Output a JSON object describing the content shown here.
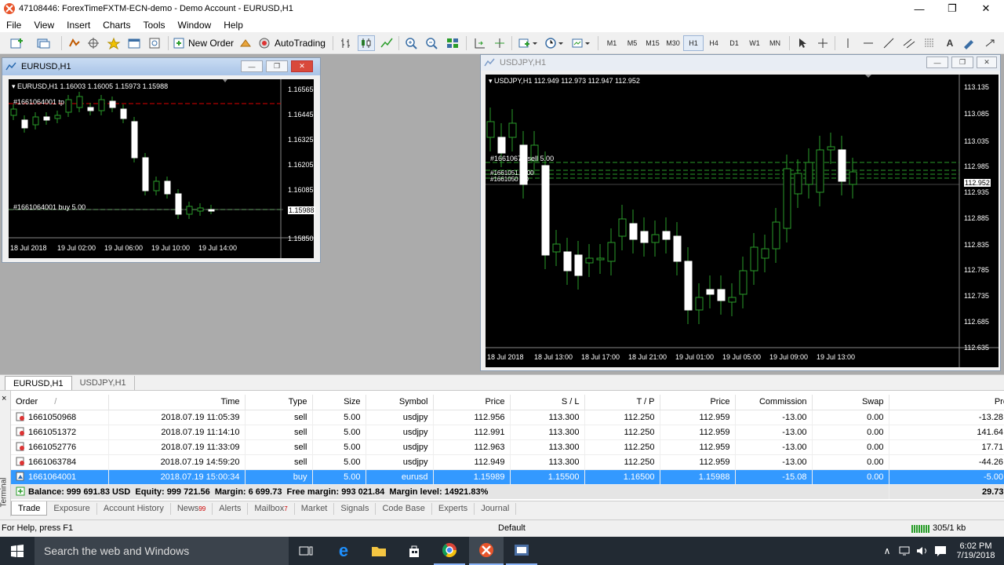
{
  "window": {
    "title": "47108446: ForexTimeFXTM-ECN-demo - Demo Account - EURUSD,H1"
  },
  "menu": [
    "File",
    "View",
    "Insert",
    "Charts",
    "Tools",
    "Window",
    "Help"
  ],
  "toolbar": {
    "new_order": "New Order",
    "autotrading": "AutoTrading",
    "timeframes": [
      "M1",
      "M5",
      "M15",
      "M30",
      "H1",
      "H4",
      "D1",
      "W1",
      "MN"
    ],
    "active_tf": "H1"
  },
  "eurusd": {
    "window_title": "EURUSD,H1",
    "header": "EURUSD,H1  1.16003 1.16005 1.15973 1.15988",
    "price_labels": [
      "1.16565",
      "1.16445",
      "1.16325",
      "1.16205",
      "1.16085",
      "1.15988",
      "1.15850"
    ],
    "time_labels": [
      "18 Jul 2018",
      "19 Jul 02:00",
      "19 Jul 06:00",
      "19 Jul 10:00",
      "19 Jul 14:00"
    ],
    "tp_label": "#1661064001 tp",
    "buy_label": "#1661064001 buy 5.00"
  },
  "usdjpy": {
    "window_title": "USDJPY,H1",
    "header": "USDJPY,H1  112.949 112.973 112.947 112.952",
    "price_labels": [
      "113.135",
      "113.085",
      "113.035",
      "112.985",
      "112.952",
      "112.935",
      "112.885",
      "112.835",
      "112.785",
      "112.735",
      "112.685",
      "112.635"
    ],
    "time_labels": [
      "18 Jul 2018",
      "18 Jul 13:00",
      "18 Jul 17:00",
      "18 Jul 21:00",
      "19 Jul 01:00",
      "19 Jul 05:00",
      "19 Jul 09:00",
      "19 Jul 13:00"
    ],
    "sell_label": "#16610672 sell 5.00",
    "sell_label_2": "#1661051. 5.00",
    "sell_label_3": "#1661050 .00"
  },
  "chart_tabs": [
    "EURUSD,H1",
    "USDJPY,H1"
  ],
  "orders": {
    "columns": [
      "Order",
      "Time",
      "Type",
      "Size",
      "Symbol",
      "Price",
      "S / L",
      "T / P",
      "Price",
      "Commission",
      "Swap",
      "Profit"
    ],
    "sort_mark": "/",
    "rows": [
      {
        "order": "1661050968",
        "time": "2018.07.19 11:05:39",
        "type": "sell",
        "size": "5.00",
        "symbol": "usdjpy",
        "price": "112.956",
        "sl": "113.300",
        "tp": "112.250",
        "cur": "112.959",
        "commission": "-13.00",
        "swap": "0.00",
        "profit": "-13.28"
      },
      {
        "order": "1661051372",
        "time": "2018.07.19 11:14:10",
        "type": "sell",
        "size": "5.00",
        "symbol": "usdjpy",
        "price": "112.991",
        "sl": "113.300",
        "tp": "112.250",
        "cur": "112.959",
        "commission": "-13.00",
        "swap": "0.00",
        "profit": "141.64"
      },
      {
        "order": "1661052776",
        "time": "2018.07.19 11:33:09",
        "type": "sell",
        "size": "5.00",
        "symbol": "usdjpy",
        "price": "112.963",
        "sl": "113.300",
        "tp": "112.250",
        "cur": "112.959",
        "commission": "-13.00",
        "swap": "0.00",
        "profit": "17.71"
      },
      {
        "order": "1661063784",
        "time": "2018.07.19 14:59:20",
        "type": "sell",
        "size": "5.00",
        "symbol": "usdjpy",
        "price": "112.949",
        "sl": "113.300",
        "tp": "112.250",
        "cur": "112.959",
        "commission": "-13.00",
        "swap": "0.00",
        "profit": "-44.26"
      },
      {
        "order": "1661064001",
        "time": "2018.07.19 15:00:34",
        "type": "buy",
        "size": "5.00",
        "symbol": "eurusd",
        "price": "1.15989",
        "sl": "1.15500",
        "tp": "1.16500",
        "cur": "1.15988",
        "commission": "-15.08",
        "swap": "0.00",
        "profit": "-5.00"
      }
    ],
    "balance_line": "Balance: 999 691.83 USD  Equity: 999 721.56  Margin: 6 699.73  Free margin: 993 021.84  Margin level: 14921.83%",
    "total_profit": "29.73"
  },
  "terminal": {
    "side_label": "Terminal",
    "close": "×"
  },
  "bottom_tabs": [
    {
      "label": "Trade",
      "badge": ""
    },
    {
      "label": "Exposure",
      "badge": ""
    },
    {
      "label": "Account History",
      "badge": ""
    },
    {
      "label": "News",
      "badge": "99"
    },
    {
      "label": "Alerts",
      "badge": ""
    },
    {
      "label": "Mailbox",
      "badge": "7"
    },
    {
      "label": "Market",
      "badge": ""
    },
    {
      "label": "Signals",
      "badge": ""
    },
    {
      "label": "Code Base",
      "badge": ""
    },
    {
      "label": "Experts",
      "badge": ""
    },
    {
      "label": "Journal",
      "badge": ""
    }
  ],
  "status": {
    "help": "For Help, press F1",
    "profile": "Default",
    "traffic": "305/1 kb"
  },
  "taskbar": {
    "search": "Search the web and Windows",
    "time": "6:02 PM",
    "date": "7/19/2018"
  },
  "colors": {
    "accent": "#3399ff",
    "bull": "#ffffff",
    "bear": "#00ff00",
    "chart_bg": "#000000"
  }
}
